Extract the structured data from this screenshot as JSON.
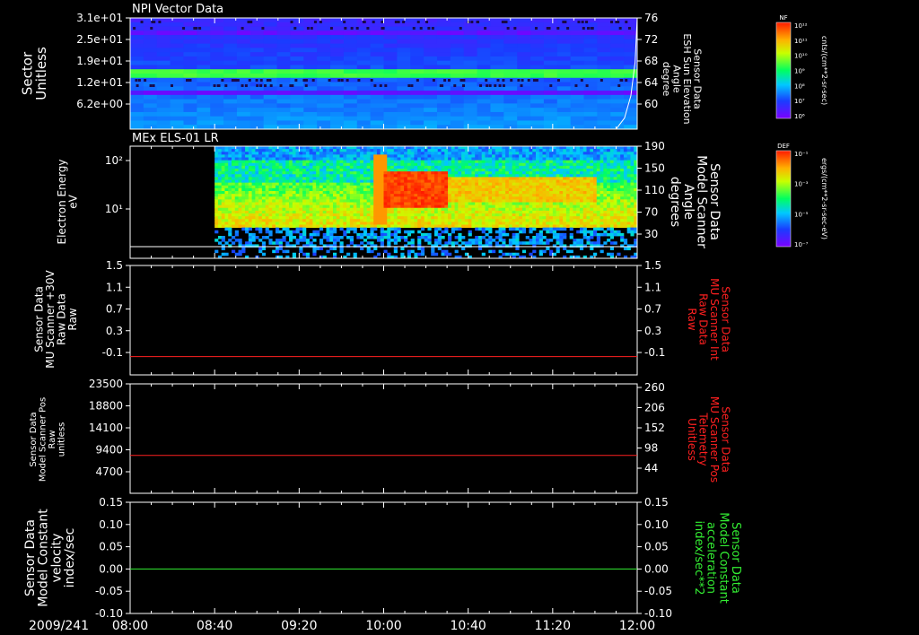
{
  "time_axis": {
    "date_label": "2009/241",
    "ticks": [
      "08:00",
      "08:40",
      "09:20",
      "10:00",
      "10:40",
      "11:20",
      "12:00"
    ]
  },
  "colors": {
    "background": "#000000",
    "axis": "#ffffff",
    "red_series": "#ff2020",
    "green_series": "#33ee33"
  },
  "chart_data": [
    {
      "type": "heatmap",
      "title": "NPI Vector Data",
      "ylabel": "Sector\nUnitless",
      "y_ticks": [
        "3.1e+01",
        "2.5e+01",
        "1.9e+01",
        "1.2e+01",
        "6.2e+00"
      ],
      "right_axis": {
        "label": "Sensor Data\nESH Sun Elevation\nAngle\ndegree",
        "ticks": [
          "76",
          "72",
          "68",
          "64",
          "60"
        ],
        "ylim": [
          56,
          76
        ]
      },
      "overlay_line": {
        "name": "ESH Sun Elevation Angle",
        "x": [
          "11:50",
          "11:54",
          "11:57",
          "11:59",
          "12:00"
        ],
        "y": [
          56,
          58,
          62,
          68,
          76
        ]
      },
      "colorbar": {
        "tag": "NF",
        "unit": "cnts/(cm**2-sr-sec)",
        "labels": [
          "10¹²",
          "10¹¹",
          "10¹⁰",
          "10⁹",
          "10⁸",
          "10⁷",
          "10⁶"
        ]
      }
    },
    {
      "type": "heatmap",
      "title": "MEx ELS-01 LR",
      "ylabel": "Electron Energy\neV",
      "y_ticks": [
        "10²",
        "10¹"
      ],
      "right_axis": {
        "label": "Sensor Data\nModel Scanner\nAngle\ndegrees",
        "ticks": [
          "190",
          "150",
          "110",
          "70",
          "30"
        ],
        "ylim": [
          0,
          190
        ]
      },
      "colorbar": {
        "tag": "DEF",
        "unit": "ergs/(cm**2-sr-sec-eV)",
        "labels": [
          "10⁻¹",
          "10⁻³",
          "10⁻⁵",
          "10⁻⁷"
        ]
      }
    },
    {
      "type": "line",
      "ylabel": "Sensor Data\nMU Scanner +30V\nRaw Data\nRaw",
      "y_ticks": [
        "1.5",
        "1.1",
        "0.7",
        "0.3",
        "-0.1"
      ],
      "ylim": [
        -0.3,
        1.5
      ],
      "right_axis": {
        "label": "Sensor Data\nMU Scanner Int\nRaw Data\nRaw",
        "ticks": [
          "1.5",
          "1.1",
          "0.7",
          "0.3",
          "-0.1"
        ]
      },
      "series": [
        {
          "name": "MU Scanner Int Raw Data",
          "color": "#ff2020",
          "x": [
            "08:00",
            "12:00"
          ],
          "values": [
            0.0,
            0.0
          ]
        }
      ]
    },
    {
      "type": "line",
      "ylabel": "Sensor Data\nModel Scanner Pos\nRaw\nunitless",
      "y_ticks": [
        "23500",
        "18800",
        "14100",
        "9400",
        "4700"
      ],
      "ylim": [
        0,
        23500
      ],
      "right_axis": {
        "label": "Sensor Data\nMU Scanner Pos\nTelemetry\nUnitless",
        "ticks": [
          "260",
          "206",
          "152",
          "98",
          "44"
        ],
        "ylim": [
          0,
          260
        ]
      },
      "series": [
        {
          "name": "MU Scanner Pos Telemetry",
          "color": "#ff2020",
          "x": [
            "08:00",
            "12:00"
          ],
          "values": [
            90,
            90
          ]
        }
      ]
    },
    {
      "type": "line",
      "ylabel": "Sensor Data\nModel Constant\nvelocity\nindex/sec",
      "y_ticks": [
        "0.15",
        "0.10",
        "0.05",
        "0.00",
        "-0.05",
        "-0.10"
      ],
      "ylim": [
        -0.1,
        0.15
      ],
      "right_axis": {
        "label": "Sensor Data\nModel Constant\nacceleration\nindex/sec**2",
        "ticks": [
          "0.15",
          "0.10",
          "0.05",
          "0.00",
          "-0.05",
          "-0.10"
        ]
      },
      "series": [
        {
          "name": "Model Constant acceleration",
          "color": "#33ee33",
          "x": [
            "08:00",
            "12:00"
          ],
          "values": [
            0.0,
            0.0
          ]
        }
      ]
    }
  ]
}
